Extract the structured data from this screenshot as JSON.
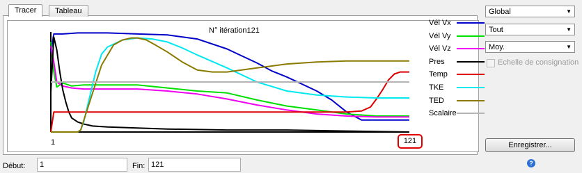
{
  "tabs": [
    {
      "label": "Tracer",
      "active": true
    },
    {
      "label": "Tableau",
      "active": false
    }
  ],
  "chart": {
    "title": "N° itération121",
    "x_start_label": "1",
    "x_end_label": "121"
  },
  "chart_data": {
    "type": "line",
    "title": "N° itération121",
    "xlabel": "",
    "ylabel": "",
    "xlim": [
      1,
      121
    ],
    "ylim": [
      0,
      1
    ],
    "legend_position": "right",
    "grid": false,
    "series": [
      {
        "name": "Vél Vx",
        "color": "#0000c8",
        "x": [
          1,
          2,
          5,
          10,
          20,
          30,
          40,
          50,
          60,
          65,
          70,
          75,
          80,
          85,
          90,
          95,
          100,
          105,
          110,
          115,
          121
        ],
        "y": [
          0.8,
          0.98,
          0.98,
          0.99,
          0.99,
          0.98,
          0.97,
          0.93,
          0.83,
          0.76,
          0.69,
          0.61,
          0.55,
          0.48,
          0.41,
          0.32,
          0.2,
          0.12,
          0.12,
          0.12,
          0.12
        ]
      },
      {
        "name": "Vél Vy",
        "color": "#00e000",
        "x": [
          1,
          2,
          3,
          5,
          8,
          12,
          20,
          30,
          40,
          50,
          60,
          70,
          80,
          90,
          100,
          110,
          121
        ],
        "y": [
          0.9,
          0.6,
          0.45,
          0.49,
          0.46,
          0.47,
          0.47,
          0.47,
          0.44,
          0.41,
          0.39,
          0.32,
          0.26,
          0.22,
          0.18,
          0.16,
          0.16
        ]
      },
      {
        "name": "Vél Vz",
        "color": "#f000f0",
        "x": [
          1,
          2,
          3,
          5,
          8,
          12,
          20,
          30,
          40,
          50,
          60,
          70,
          80,
          90,
          100,
          110,
          121
        ],
        "y": [
          0.86,
          0.7,
          0.5,
          0.46,
          0.44,
          0.43,
          0.43,
          0.43,
          0.41,
          0.38,
          0.33,
          0.27,
          0.22,
          0.18,
          0.16,
          0.15,
          0.15
        ]
      },
      {
        "name": "Pres",
        "color": "#000000",
        "x": [
          1,
          2,
          3,
          4,
          5,
          6,
          7,
          8,
          10,
          12,
          15,
          20,
          30,
          40,
          60,
          80,
          100,
          121
        ],
        "y": [
          0.4,
          0.95,
          0.82,
          0.6,
          0.42,
          0.3,
          0.2,
          0.14,
          0.1,
          0.08,
          0.06,
          0.05,
          0.04,
          0.03,
          0.02,
          0.02,
          0.01,
          0.0
        ]
      },
      {
        "name": "Temp",
        "color": "#dd0000",
        "x": [
          1,
          2,
          20,
          60,
          100,
          105,
          108,
          110,
          112,
          114,
          116,
          118,
          121
        ],
        "y": [
          0.0,
          0.2,
          0.2,
          0.2,
          0.2,
          0.21,
          0.25,
          0.33,
          0.42,
          0.52,
          0.58,
          0.6,
          0.6
        ]
      },
      {
        "name": "TKE",
        "color": "#00e8f0",
        "x": [
          1,
          10,
          11,
          12,
          14,
          16,
          18,
          20,
          25,
          30,
          35,
          40,
          45,
          50,
          60,
          70,
          80,
          90,
          100,
          110,
          121
        ],
        "y": [
          0.0,
          0.0,
          0.02,
          0.1,
          0.35,
          0.6,
          0.78,
          0.85,
          0.92,
          0.94,
          0.93,
          0.9,
          0.84,
          0.77,
          0.64,
          0.5,
          0.41,
          0.37,
          0.35,
          0.34,
          0.34
        ]
      },
      {
        "name": "TED",
        "color": "#8a7a00",
        "x": [
          1,
          10,
          11,
          14,
          18,
          22,
          25,
          28,
          30,
          33,
          36,
          40,
          45,
          50,
          55,
          60,
          70,
          80,
          90,
          100,
          110,
          121
        ],
        "y": [
          0.0,
          0.0,
          0.02,
          0.3,
          0.67,
          0.87,
          0.92,
          0.94,
          0.94,
          0.92,
          0.87,
          0.8,
          0.7,
          0.62,
          0.6,
          0.6,
          0.64,
          0.68,
          0.7,
          0.71,
          0.71,
          0.71
        ]
      },
      {
        "name": "Scalaire",
        "color": "#b4b4b4",
        "x": [
          1,
          121
        ],
        "y": [
          0.5,
          0.5
        ]
      }
    ]
  },
  "right_panel": {
    "dropdowns": [
      {
        "value": "Global"
      },
      {
        "value": "Tout"
      },
      {
        "value": "Moy."
      }
    ],
    "checkbox_label": "Echelle de consignation",
    "checkbox_checked": false,
    "save_button_label": "Enregistrer..."
  },
  "bottom": {
    "debut_label": "Début:",
    "debut_value": "1",
    "fin_label": "Fin:",
    "fin_value": "121"
  }
}
